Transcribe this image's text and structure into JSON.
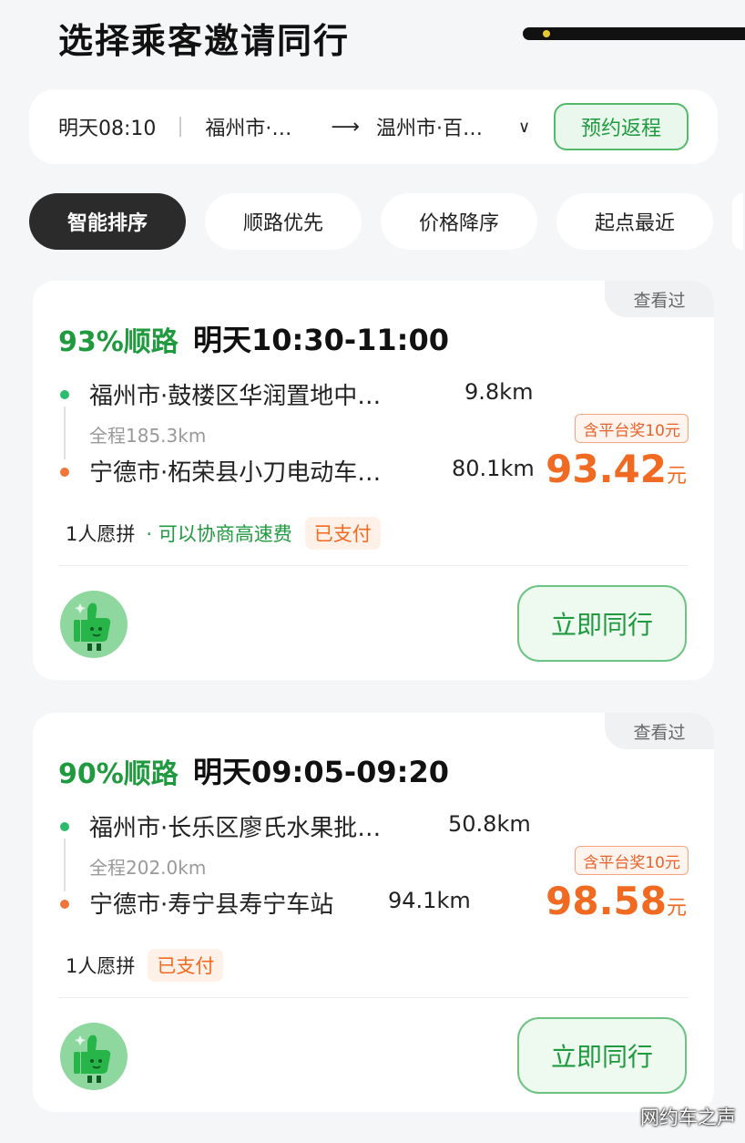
{
  "page": {
    "title": "选择乘客邀请同行"
  },
  "route_bar": {
    "time": "明天08:10",
    "from": "福州市·…",
    "arrow": "→",
    "to": "温州市·百…",
    "return_label": "预约返程"
  },
  "sort_tabs": [
    {
      "label": "智能排序",
      "active": true
    },
    {
      "label": "顺路优先",
      "active": false
    },
    {
      "label": "价格降序",
      "active": false
    },
    {
      "label": "起点最近",
      "active": false
    }
  ],
  "orders": [
    {
      "viewed": "查看过",
      "match": "93%顺路",
      "time_range": "明天10:30-11:00",
      "from": "福州市·鼓楼区华润置地中…",
      "from_distance": "9.8km",
      "total": "全程185.3km",
      "to": "宁德市·柘荣县小刀电动车…",
      "to_distance": "80.1km",
      "reward": "含平台奖10元",
      "price": "93.42",
      "price_unit": "元",
      "passengers": "1人愿拼",
      "toll": "· 可以协商高速费",
      "paid": "已支付",
      "action": "立即同行"
    },
    {
      "viewed": "查看过",
      "match": "90%顺路",
      "time_range": "明天09:05-09:20",
      "from": "福州市·长乐区廖氏水果批…",
      "from_distance": "50.8km",
      "total": "全程202.0km",
      "to": "宁德市·寿宁县寿宁车站",
      "to_distance": "94.1km",
      "reward": "含平台奖10元",
      "price": "98.58",
      "price_unit": "元",
      "passengers": "1人愿拼",
      "toll": "",
      "paid": "已支付",
      "action": "立即同行"
    }
  ],
  "watermark": "网约车之声",
  "colors": {
    "accent_green": "#1f9a3e",
    "price_orange": "#f06a22",
    "active_tab": "#2b2b2b"
  }
}
